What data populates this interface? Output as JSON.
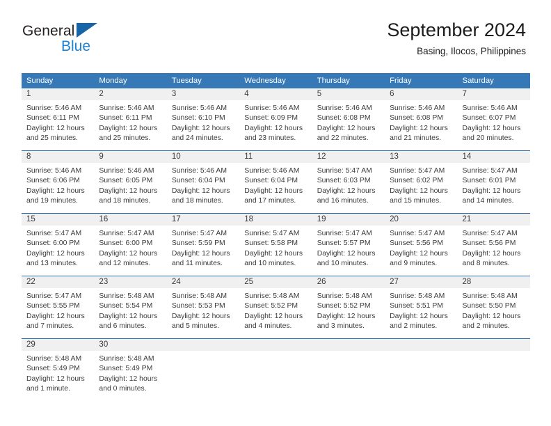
{
  "brand": {
    "name_part1": "General",
    "name_part2": "Blue",
    "triangle_color": "#1565a8",
    "blue_color": "#1d83d4"
  },
  "header": {
    "title": "September 2024",
    "subtitle": "Basing, Ilocos, Philippines"
  },
  "theme": {
    "header_bg": "#3778b6",
    "row_divider": "#2b6cab",
    "daynum_band": "#f0f0f0",
    "text": "#3a3a3a"
  },
  "weekday_headers": [
    "Sunday",
    "Monday",
    "Tuesday",
    "Wednesday",
    "Thursday",
    "Friday",
    "Saturday"
  ],
  "weeks": [
    [
      {
        "day": "1",
        "sunrise": "Sunrise: 5:46 AM",
        "sunset": "Sunset: 6:11 PM",
        "daylight_line1": "Daylight: 12 hours",
        "daylight_line2": "and 25 minutes."
      },
      {
        "day": "2",
        "sunrise": "Sunrise: 5:46 AM",
        "sunset": "Sunset: 6:11 PM",
        "daylight_line1": "Daylight: 12 hours",
        "daylight_line2": "and 25 minutes."
      },
      {
        "day": "3",
        "sunrise": "Sunrise: 5:46 AM",
        "sunset": "Sunset: 6:10 PM",
        "daylight_line1": "Daylight: 12 hours",
        "daylight_line2": "and 24 minutes."
      },
      {
        "day": "4",
        "sunrise": "Sunrise: 5:46 AM",
        "sunset": "Sunset: 6:09 PM",
        "daylight_line1": "Daylight: 12 hours",
        "daylight_line2": "and 23 minutes."
      },
      {
        "day": "5",
        "sunrise": "Sunrise: 5:46 AM",
        "sunset": "Sunset: 6:08 PM",
        "daylight_line1": "Daylight: 12 hours",
        "daylight_line2": "and 22 minutes."
      },
      {
        "day": "6",
        "sunrise": "Sunrise: 5:46 AM",
        "sunset": "Sunset: 6:08 PM",
        "daylight_line1": "Daylight: 12 hours",
        "daylight_line2": "and 21 minutes."
      },
      {
        "day": "7",
        "sunrise": "Sunrise: 5:46 AM",
        "sunset": "Sunset: 6:07 PM",
        "daylight_line1": "Daylight: 12 hours",
        "daylight_line2": "and 20 minutes."
      }
    ],
    [
      {
        "day": "8",
        "sunrise": "Sunrise: 5:46 AM",
        "sunset": "Sunset: 6:06 PM",
        "daylight_line1": "Daylight: 12 hours",
        "daylight_line2": "and 19 minutes."
      },
      {
        "day": "9",
        "sunrise": "Sunrise: 5:46 AM",
        "sunset": "Sunset: 6:05 PM",
        "daylight_line1": "Daylight: 12 hours",
        "daylight_line2": "and 18 minutes."
      },
      {
        "day": "10",
        "sunrise": "Sunrise: 5:46 AM",
        "sunset": "Sunset: 6:04 PM",
        "daylight_line1": "Daylight: 12 hours",
        "daylight_line2": "and 18 minutes."
      },
      {
        "day": "11",
        "sunrise": "Sunrise: 5:46 AM",
        "sunset": "Sunset: 6:04 PM",
        "daylight_line1": "Daylight: 12 hours",
        "daylight_line2": "and 17 minutes."
      },
      {
        "day": "12",
        "sunrise": "Sunrise: 5:47 AM",
        "sunset": "Sunset: 6:03 PM",
        "daylight_line1": "Daylight: 12 hours",
        "daylight_line2": "and 16 minutes."
      },
      {
        "day": "13",
        "sunrise": "Sunrise: 5:47 AM",
        "sunset": "Sunset: 6:02 PM",
        "daylight_line1": "Daylight: 12 hours",
        "daylight_line2": "and 15 minutes."
      },
      {
        "day": "14",
        "sunrise": "Sunrise: 5:47 AM",
        "sunset": "Sunset: 6:01 PM",
        "daylight_line1": "Daylight: 12 hours",
        "daylight_line2": "and 14 minutes."
      }
    ],
    [
      {
        "day": "15",
        "sunrise": "Sunrise: 5:47 AM",
        "sunset": "Sunset: 6:00 PM",
        "daylight_line1": "Daylight: 12 hours",
        "daylight_line2": "and 13 minutes."
      },
      {
        "day": "16",
        "sunrise": "Sunrise: 5:47 AM",
        "sunset": "Sunset: 6:00 PM",
        "daylight_line1": "Daylight: 12 hours",
        "daylight_line2": "and 12 minutes."
      },
      {
        "day": "17",
        "sunrise": "Sunrise: 5:47 AM",
        "sunset": "Sunset: 5:59 PM",
        "daylight_line1": "Daylight: 12 hours",
        "daylight_line2": "and 11 minutes."
      },
      {
        "day": "18",
        "sunrise": "Sunrise: 5:47 AM",
        "sunset": "Sunset: 5:58 PM",
        "daylight_line1": "Daylight: 12 hours",
        "daylight_line2": "and 10 minutes."
      },
      {
        "day": "19",
        "sunrise": "Sunrise: 5:47 AM",
        "sunset": "Sunset: 5:57 PM",
        "daylight_line1": "Daylight: 12 hours",
        "daylight_line2": "and 10 minutes."
      },
      {
        "day": "20",
        "sunrise": "Sunrise: 5:47 AM",
        "sunset": "Sunset: 5:56 PM",
        "daylight_line1": "Daylight: 12 hours",
        "daylight_line2": "and 9 minutes."
      },
      {
        "day": "21",
        "sunrise": "Sunrise: 5:47 AM",
        "sunset": "Sunset: 5:56 PM",
        "daylight_line1": "Daylight: 12 hours",
        "daylight_line2": "and 8 minutes."
      }
    ],
    [
      {
        "day": "22",
        "sunrise": "Sunrise: 5:47 AM",
        "sunset": "Sunset: 5:55 PM",
        "daylight_line1": "Daylight: 12 hours",
        "daylight_line2": "and 7 minutes."
      },
      {
        "day": "23",
        "sunrise": "Sunrise: 5:48 AM",
        "sunset": "Sunset: 5:54 PM",
        "daylight_line1": "Daylight: 12 hours",
        "daylight_line2": "and 6 minutes."
      },
      {
        "day": "24",
        "sunrise": "Sunrise: 5:48 AM",
        "sunset": "Sunset: 5:53 PM",
        "daylight_line1": "Daylight: 12 hours",
        "daylight_line2": "and 5 minutes."
      },
      {
        "day": "25",
        "sunrise": "Sunrise: 5:48 AM",
        "sunset": "Sunset: 5:52 PM",
        "daylight_line1": "Daylight: 12 hours",
        "daylight_line2": "and 4 minutes."
      },
      {
        "day": "26",
        "sunrise": "Sunrise: 5:48 AM",
        "sunset": "Sunset: 5:52 PM",
        "daylight_line1": "Daylight: 12 hours",
        "daylight_line2": "and 3 minutes."
      },
      {
        "day": "27",
        "sunrise": "Sunrise: 5:48 AM",
        "sunset": "Sunset: 5:51 PM",
        "daylight_line1": "Daylight: 12 hours",
        "daylight_line2": "and 2 minutes."
      },
      {
        "day": "28",
        "sunrise": "Sunrise: 5:48 AM",
        "sunset": "Sunset: 5:50 PM",
        "daylight_line1": "Daylight: 12 hours",
        "daylight_line2": "and 2 minutes."
      }
    ],
    [
      {
        "day": "29",
        "sunrise": "Sunrise: 5:48 AM",
        "sunset": "Sunset: 5:49 PM",
        "daylight_line1": "Daylight: 12 hours",
        "daylight_line2": "and 1 minute."
      },
      {
        "day": "30",
        "sunrise": "Sunrise: 5:48 AM",
        "sunset": "Sunset: 5:49 PM",
        "daylight_line1": "Daylight: 12 hours",
        "daylight_line2": "and 0 minutes."
      },
      {
        "day": "",
        "sunrise": "",
        "sunset": "",
        "daylight_line1": "",
        "daylight_line2": ""
      },
      {
        "day": "",
        "sunrise": "",
        "sunset": "",
        "daylight_line1": "",
        "daylight_line2": ""
      },
      {
        "day": "",
        "sunrise": "",
        "sunset": "",
        "daylight_line1": "",
        "daylight_line2": ""
      },
      {
        "day": "",
        "sunrise": "",
        "sunset": "",
        "daylight_line1": "",
        "daylight_line2": ""
      },
      {
        "day": "",
        "sunrise": "",
        "sunset": "",
        "daylight_line1": "",
        "daylight_line2": ""
      }
    ]
  ]
}
